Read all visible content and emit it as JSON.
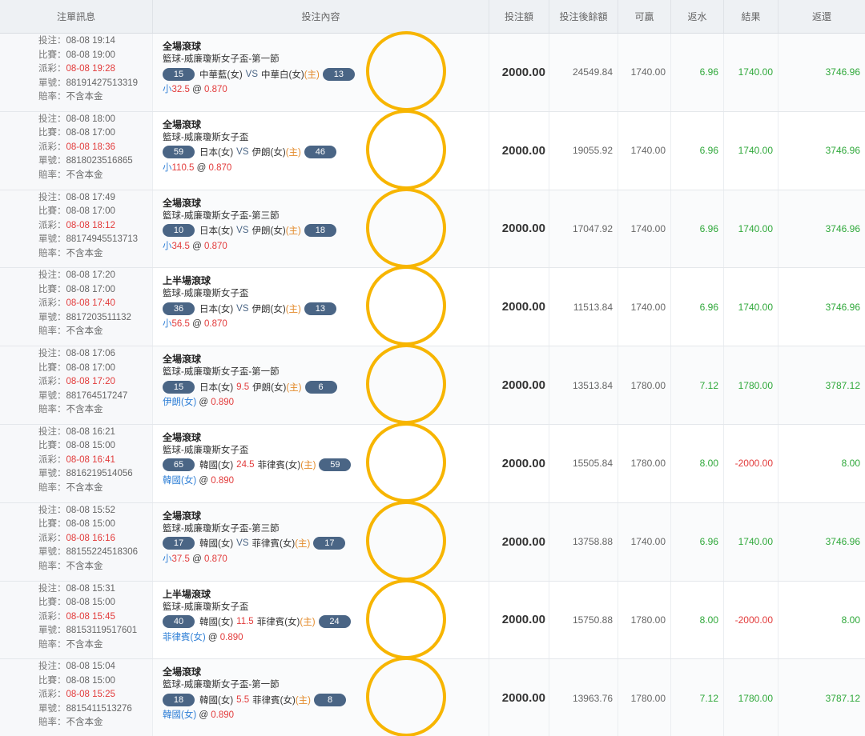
{
  "headers": {
    "info": "注單訊息",
    "content": "投注內容",
    "stake": "投注額",
    "balance": "投注後餘額",
    "win": "可贏",
    "rebate": "返水",
    "result": "結果",
    "return": "返還"
  },
  "labels": {
    "bet": "投注：",
    "match": "比賽：",
    "settle": "派彩：",
    "order": "單號：",
    "odds_type": "賠率："
  },
  "vs_text": "VS",
  "home_text": "(主)",
  "at_text": "@",
  "colors": {
    "header_bg": "#eef1f4",
    "pill": "#4a6585",
    "red": "#e23b3b",
    "green": "#2fa83a",
    "blue": "#2f7fd6",
    "home": "#e38b2c",
    "circle": "#f7b500"
  },
  "rows": [
    {
      "bet_time": "08-08 19:14",
      "match_time": "08-08 19:00",
      "settle_time": "08-08 19:28",
      "order_no": "88191427513319",
      "odds_type": "不含本金",
      "bet_type": "全場滾球",
      "league": "籃球-威廉瓊斯女子盃-第一節",
      "left_score": "15",
      "team_a": "中華藍(女)",
      "middle": "VS",
      "team_b": "中華白(女)",
      "right_score": "13",
      "pick": "小",
      "line": "32.5",
      "odds": "0.870",
      "stake": "2000.00",
      "balance": "24549.84",
      "win": "1740.00",
      "rebate": "6.96",
      "result": "1740.00",
      "result_type": "green",
      "return": "3746.96"
    },
    {
      "bet_time": "08-08 18:00",
      "match_time": "08-08 17:00",
      "settle_time": "08-08 18:36",
      "order_no": "8818023516865",
      "odds_type": "不含本金",
      "bet_type": "全場滾球",
      "league": "籃球-威廉瓊斯女子盃",
      "left_score": "59",
      "team_a": "日本(女)",
      "middle": "VS",
      "team_b": "伊朗(女)",
      "right_score": "46",
      "pick": "小",
      "line": "110.5",
      "odds": "0.870",
      "stake": "2000.00",
      "balance": "19055.92",
      "win": "1740.00",
      "rebate": "6.96",
      "result": "1740.00",
      "result_type": "green",
      "return": "3746.96"
    },
    {
      "bet_time": "08-08 17:49",
      "match_time": "08-08 17:00",
      "settle_time": "08-08 18:12",
      "order_no": "88174945513713",
      "odds_type": "不含本金",
      "bet_type": "全場滾球",
      "league": "籃球-威廉瓊斯女子盃-第三節",
      "left_score": "10",
      "team_a": "日本(女)",
      "middle": "VS",
      "team_b": "伊朗(女)",
      "right_score": "18",
      "pick": "小",
      "line": "34.5",
      "odds": "0.870",
      "stake": "2000.00",
      "balance": "17047.92",
      "win": "1740.00",
      "rebate": "6.96",
      "result": "1740.00",
      "result_type": "green",
      "return": "3746.96"
    },
    {
      "bet_time": "08-08 17:20",
      "match_time": "08-08 17:00",
      "settle_time": "08-08 17:40",
      "order_no": "8817203511132",
      "odds_type": "不含本金",
      "bet_type": "上半場滾球",
      "league": "籃球-威廉瓊斯女子盃",
      "left_score": "36",
      "team_a": "日本(女)",
      "middle": "VS",
      "team_b": "伊朗(女)",
      "right_score": "13",
      "pick": "小",
      "line": "56.5",
      "odds": "0.870",
      "stake": "2000.00",
      "balance": "11513.84",
      "win": "1740.00",
      "rebate": "6.96",
      "result": "1740.00",
      "result_type": "green",
      "return": "3746.96"
    },
    {
      "bet_time": "08-08 17:06",
      "match_time": "08-08 17:00",
      "settle_time": "08-08 17:20",
      "order_no": "881764517247",
      "odds_type": "不含本金",
      "bet_type": "全場滾球",
      "league": "籃球-威廉瓊斯女子盃-第一節",
      "left_score": "15",
      "team_a": "日本(女)",
      "middle": "9.5",
      "team_b": "伊朗(女)",
      "right_score": "6",
      "pick": "伊朗(女)",
      "line": "",
      "odds": "0.890",
      "stake": "2000.00",
      "balance": "13513.84",
      "win": "1780.00",
      "rebate": "7.12",
      "result": "1780.00",
      "result_type": "green",
      "return": "3787.12"
    },
    {
      "bet_time": "08-08 16:21",
      "match_time": "08-08 15:00",
      "settle_time": "08-08 16:41",
      "order_no": "8816219514056",
      "odds_type": "不含本金",
      "bet_type": "全場滾球",
      "league": "籃球-威廉瓊斯女子盃",
      "left_score": "65",
      "team_a": "韓國(女)",
      "middle": "24.5",
      "team_b": "菲律賓(女)",
      "right_score": "59",
      "pick": "韓國(女)",
      "line": "",
      "odds": "0.890",
      "stake": "2000.00",
      "balance": "15505.84",
      "win": "1780.00",
      "rebate": "8.00",
      "result": "-2000.00",
      "result_type": "red",
      "return": "8.00"
    },
    {
      "bet_time": "08-08 15:52",
      "match_time": "08-08 15:00",
      "settle_time": "08-08 16:16",
      "order_no": "88155224518306",
      "odds_type": "不含本金",
      "bet_type": "全場滾球",
      "league": "籃球-威廉瓊斯女子盃-第三節",
      "left_score": "17",
      "team_a": "韓國(女)",
      "middle": "VS",
      "team_b": "菲律賓(女)",
      "right_score": "17",
      "pick": "小",
      "line": "37.5",
      "odds": "0.870",
      "stake": "2000.00",
      "balance": "13758.88",
      "win": "1740.00",
      "rebate": "6.96",
      "result": "1740.00",
      "result_type": "green",
      "return": "3746.96"
    },
    {
      "bet_time": "08-08 15:31",
      "match_time": "08-08 15:00",
      "settle_time": "08-08 15:45",
      "order_no": "88153119517601",
      "odds_type": "不含本金",
      "bet_type": "上半場滾球",
      "league": "籃球-威廉瓊斯女子盃",
      "left_score": "40",
      "team_a": "韓國(女)",
      "middle": "11.5",
      "team_b": "菲律賓(女)",
      "right_score": "24",
      "pick": "菲律賓(女)",
      "line": "",
      "odds": "0.890",
      "stake": "2000.00",
      "balance": "15750.88",
      "win": "1780.00",
      "rebate": "8.00",
      "result": "-2000.00",
      "result_type": "red",
      "return": "8.00"
    },
    {
      "bet_time": "08-08 15:04",
      "match_time": "08-08 15:00",
      "settle_time": "08-08 15:25",
      "order_no": "8815411513276",
      "odds_type": "不含本金",
      "bet_type": "全場滾球",
      "league": "籃球-威廉瓊斯女子盃-第一節",
      "left_score": "18",
      "team_a": "韓國(女)",
      "middle": "5.5",
      "team_b": "菲律賓(女)",
      "right_score": "8",
      "pick": "韓國(女)",
      "line": "",
      "odds": "0.890",
      "stake": "2000.00",
      "balance": "13963.76",
      "win": "1780.00",
      "rebate": "7.12",
      "result": "1780.00",
      "result_type": "green",
      "return": "3787.12"
    }
  ]
}
